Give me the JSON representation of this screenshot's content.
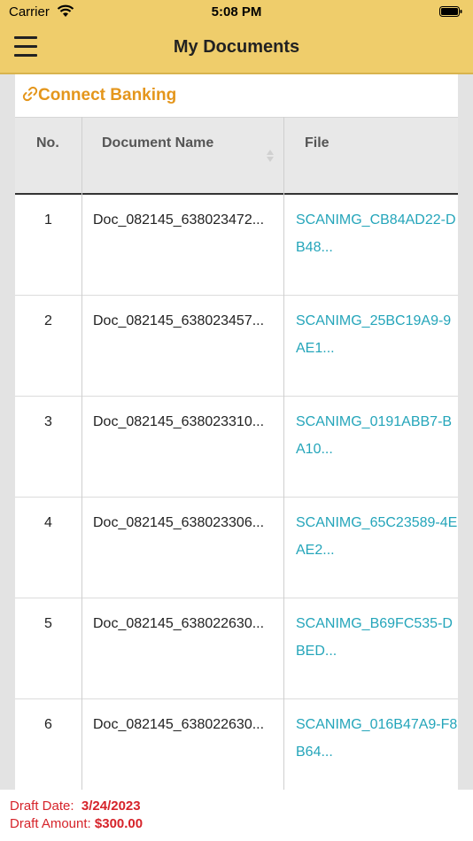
{
  "status": {
    "carrier": "Carrier",
    "time": "5:08 PM"
  },
  "header": {
    "title": "My Documents"
  },
  "connect": {
    "label": "Connect Banking"
  },
  "table": {
    "headers": {
      "no": "No.",
      "name": "Document Name",
      "file": "File"
    },
    "rows": [
      {
        "no": "1",
        "name": "Doc_082145_638023472...",
        "file1": "SCANIMG_CB84AD22-D",
        "file2": "B48..."
      },
      {
        "no": "2",
        "name": "Doc_082145_638023457...",
        "file1": "SCANIMG_25BC19A9-9",
        "file2": "AE1..."
      },
      {
        "no": "3",
        "name": "Doc_082145_638023310...",
        "file1": "SCANIMG_0191ABB7-B",
        "file2": "A10..."
      },
      {
        "no": "4",
        "name": "Doc_082145_638023306...",
        "file1": "SCANIMG_65C23589-4E",
        "file2": "AE2..."
      },
      {
        "no": "5",
        "name": "Doc_082145_638022630...",
        "file1": "SCANIMG_B69FC535-D",
        "file2": "BED..."
      },
      {
        "no": "6",
        "name": "Doc_082145_638022630...",
        "file1": "SCANIMG_016B47A9-F8",
        "file2": "B64..."
      }
    ]
  },
  "footer": {
    "draft_date_label": "Draft Date:",
    "draft_date": "3/24/2023",
    "draft_amount_label": "Draft Amount:",
    "draft_amount": "$300.00"
  },
  "colors": {
    "header_bg": "#efcd6b",
    "accent": "#e4961c",
    "link": "#24a5ba",
    "footer_text": "#d6232a"
  }
}
